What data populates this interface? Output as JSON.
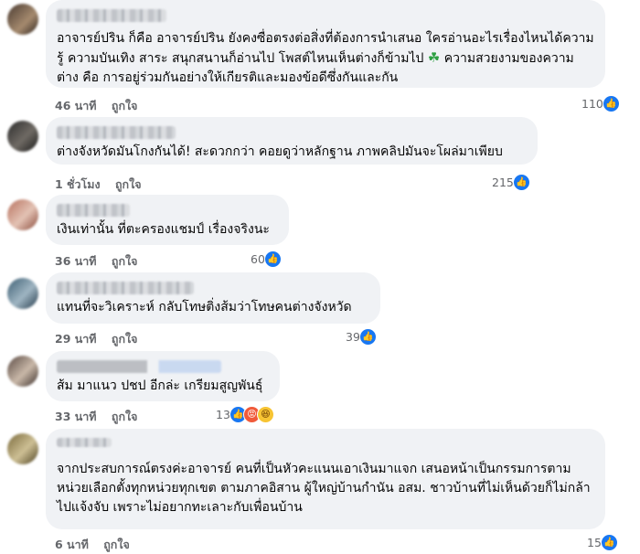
{
  "comments": [
    {
      "avatar_colors": [
        "#4a3b32",
        "#a58a6e"
      ],
      "text": "อาจารย์ปริน ก็คือ อาจารย์ปริน ยังคงซื่อตรงต่อสิ่งที่ต้องการนำเสนอ ใครอ่านอะไรเรื่องไหนได้ความรู้ ความบันเทิง สาระ สนุกสนานก็อ่านไป โพสต์ไหนเห็นต่างก็ข้ามไป",
      "text_suffix": "ความสวยงามของความต่าง คือ การอยู่ร่วมกันอย่างให้เกียรติและมองข้อดีซึ่งกันและกัน",
      "time": "46 นาที",
      "like_label": "ถูกใจ",
      "reaction_count": "110",
      "reactions": [
        "like-icon"
      ]
    },
    {
      "avatar_colors": [
        "#2c2c2c",
        "#6f6a64"
      ],
      "text": "ต่างจังหวัดมันโกงกันได้! สะดวกกว่า คอยดูว่าหลักฐาน ภาพคลิปมันจะโผล่มาเพียบ",
      "time": "1 ชั่วโมง",
      "like_label": "ถูกใจ",
      "reaction_count": "215",
      "reactions": [
        "like-icon"
      ]
    },
    {
      "avatar_colors": [
        "#b8725f",
        "#e3c2b4"
      ],
      "text": "เงินเท่านั้น ที่ตะครองแชมป์ เรื่องจริงนะ",
      "time": "36 นาที",
      "like_label": "ถูกใจ",
      "reaction_count": "60",
      "reactions": [
        "like-icon"
      ]
    },
    {
      "avatar_colors": [
        "#3e5f74",
        "#9fb5c2"
      ],
      "text": "แทนที่จะวิเคราะห์ กลับโทษติ่งส้มว่าโทษคนต่างจังหวัด",
      "time": "29 นาที",
      "like_label": "ถูกใจ",
      "reaction_count": "39",
      "reactions": [
        "like-icon"
      ]
    },
    {
      "avatar_colors": [
        "#5a4a44",
        "#c9b8a8"
      ],
      "text": "ส้ม มาแนว ปชป อีกล่ะ เกรียมสูญพันธุ์",
      "time": "33 นาที",
      "like_label": "ถูกใจ",
      "reaction_count": "13",
      "reactions": [
        "like-icon",
        "angry-icon",
        "haha-icon"
      ]
    },
    {
      "avatar_colors": [
        "#7a6a3c",
        "#cdbf94"
      ],
      "text": "จากประสบการณ์ตรงค่ะอาจารย์ คนที่เป็นหัวคะแนนเอาเงินมาแจก เสนอหน้าเป็นกรรมการตามหน่วยเลือกตั้งทุกหน่วยทุกเขต ตามภาคอิสาน ผู้ใหญ่บ้านกำนัน อสม. ชาวบ้านที่ไม่เห็นด้วยก็ไม่กล้าไปแจ้งจับ เพราะไม่อยากทะเลาะกับเพื่อนบ้าน",
      "time": "6 นาที",
      "like_label": "ถูกใจ",
      "reaction_count": "15",
      "reactions": [
        "like-icon"
      ]
    }
  ]
}
